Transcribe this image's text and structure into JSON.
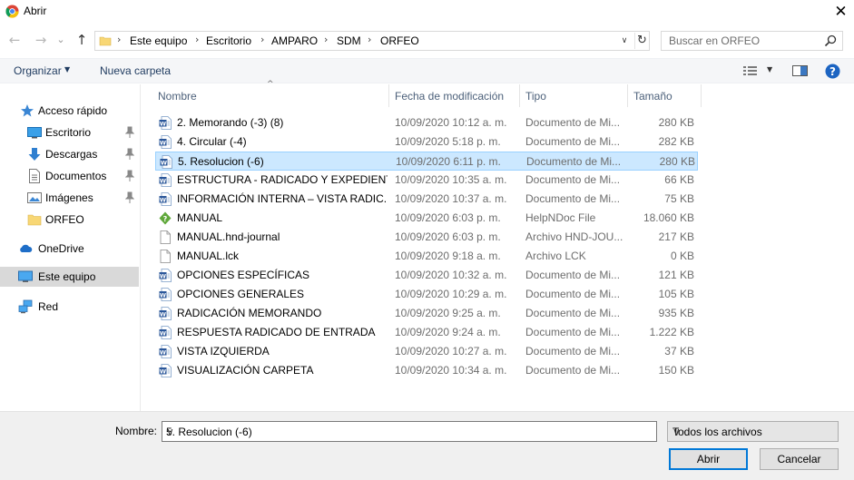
{
  "window": {
    "title": "Abrir",
    "close_glyph": "✕"
  },
  "nav": {
    "back_glyph": "←",
    "forward_glyph": "→",
    "recent_glyph": "⌄",
    "up_glyph": "↑",
    "breadcrumbs": [
      "Este equipo",
      "Escritorio",
      "AMPARO",
      "SDM",
      "ORFEO"
    ],
    "crumb_separator": "›",
    "dropdown_glyph": "∨",
    "refresh_glyph": "↻"
  },
  "search": {
    "placeholder": "Buscar en ORFEO"
  },
  "toolbar": {
    "organize_label": "Organizar",
    "new_folder_label": "Nueva carpeta",
    "caret": "▼"
  },
  "sidebar": {
    "items": [
      {
        "label": "Acceso rápido",
        "icon": "star-icon"
      },
      {
        "label": "Escritorio",
        "icon": "desktop-icon",
        "pinned": true
      },
      {
        "label": "Descargas",
        "icon": "download-icon",
        "pinned": true
      },
      {
        "label": "Documentos",
        "icon": "documents-icon",
        "pinned": true
      },
      {
        "label": "Imágenes",
        "icon": "pictures-icon",
        "pinned": true
      },
      {
        "label": "ORFEO",
        "icon": "folder-icon"
      },
      {
        "label": "OneDrive",
        "icon": "cloud-icon"
      },
      {
        "label": "Este equipo",
        "icon": "computer-icon"
      },
      {
        "label": "Red",
        "icon": "network-icon"
      }
    ]
  },
  "columns": {
    "name": "Nombre",
    "date": "Fecha de modificación",
    "type": "Tipo",
    "size": "Tamaño",
    "sort_glyph": "^"
  },
  "files": [
    {
      "name": "2. Memorando (-3) (8)",
      "date": "10/09/2020 10:12 a. m.",
      "type": "Documento de Mi...",
      "size": "280 KB",
      "icon": "word"
    },
    {
      "name": "4. Circular (-4)",
      "date": "10/09/2020 5:18 p. m.",
      "type": "Documento de Mi...",
      "size": "282 KB",
      "icon": "word"
    },
    {
      "name": "5. Resolucion (-6)",
      "date": "10/09/2020 6:11 p. m.",
      "type": "Documento de Mi...",
      "size": "280 KB",
      "icon": "word",
      "selected": true
    },
    {
      "name": "ESTRUCTURA - RADICADO Y EXPEDIENTE...",
      "date": "10/09/2020 10:35 a. m.",
      "type": "Documento de Mi...",
      "size": "66 KB",
      "icon": "word"
    },
    {
      "name": "INFORMACIÓN INTERNA – VISTA RADIC...",
      "date": "10/09/2020 10:37 a. m.",
      "type": "Documento de Mi...",
      "size": "75 KB",
      "icon": "word"
    },
    {
      "name": "MANUAL",
      "date": "10/09/2020 6:03 p. m.",
      "type": "HelpNDoc File",
      "size": "18.060 KB",
      "icon": "helpndoc"
    },
    {
      "name": "MANUAL.hnd-journal",
      "date": "10/09/2020 6:03 p. m.",
      "type": "Archivo HND-JOU...",
      "size": "217 KB",
      "icon": "blank"
    },
    {
      "name": "MANUAL.lck",
      "date": "10/09/2020 9:18 a. m.",
      "type": "Archivo LCK",
      "size": "0 KB",
      "icon": "blank"
    },
    {
      "name": "OPCIONES ESPECÍFICAS",
      "date": "10/09/2020 10:32 a. m.",
      "type": "Documento de Mi...",
      "size": "121 KB",
      "icon": "word"
    },
    {
      "name": "OPCIONES GENERALES",
      "date": "10/09/2020 10:29 a. m.",
      "type": "Documento de Mi...",
      "size": "105 KB",
      "icon": "word"
    },
    {
      "name": "RADICACIÓN MEMORANDO",
      "date": "10/09/2020 9:25 a. m.",
      "type": "Documento de Mi...",
      "size": "935 KB",
      "icon": "word"
    },
    {
      "name": "RESPUESTA RADICADO DE ENTRADA",
      "date": "10/09/2020 9:24 a. m.",
      "type": "Documento de Mi...",
      "size": "1.222 KB",
      "icon": "word"
    },
    {
      "name": "VISTA IZQUIERDA",
      "date": "10/09/2020 10:27 a. m.",
      "type": "Documento de Mi...",
      "size": "37 KB",
      "icon": "word"
    },
    {
      "name": "VISUALIZACIÓN CARPETA",
      "date": "10/09/2020 10:34 a. m.",
      "type": "Documento de Mi...",
      "size": "150 KB",
      "icon": "word"
    }
  ],
  "footer": {
    "filename_label": "Nombre:",
    "filename_value": "5. Resolucion (-6)",
    "filetype_value": "Todos los archivos",
    "open_label": "Abrir",
    "cancel_label": "Cancelar",
    "drop_glyph": "∨"
  },
  "colors": {
    "selection": "#cce8ff",
    "selection_border": "#99d1ff",
    "accent": "#0078d7",
    "word_blue": "#2b579a"
  }
}
